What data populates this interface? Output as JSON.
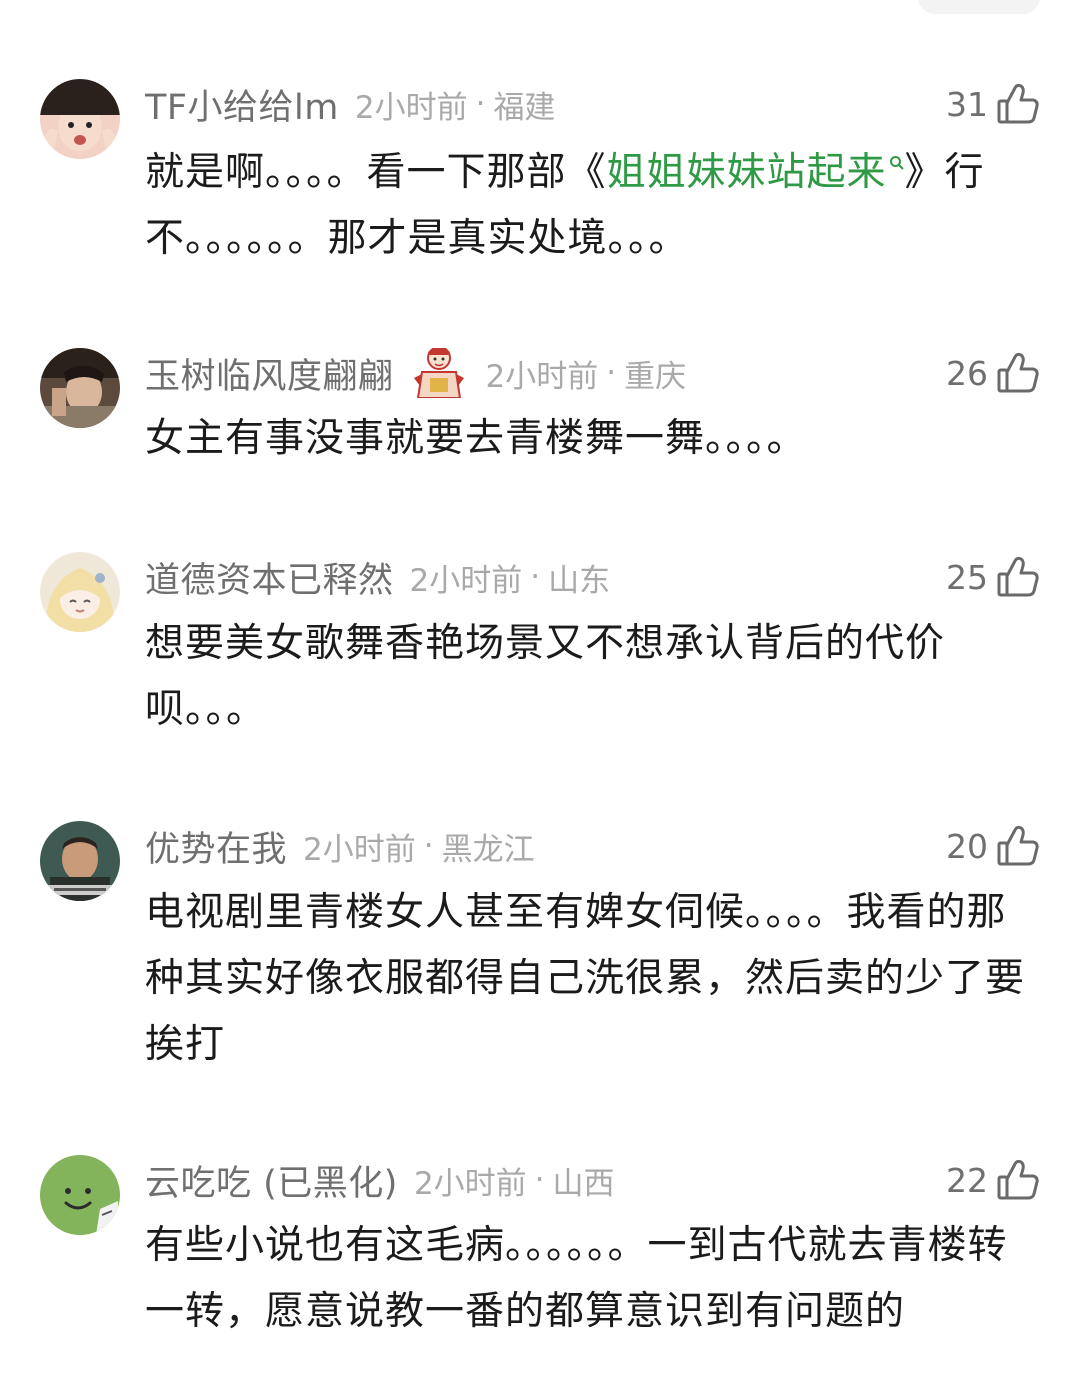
{
  "comments": [
    {
      "username": "TF小给给lm",
      "time": "2小时前",
      "separator": "·",
      "region": "福建",
      "likes": "31",
      "text_before": "就是啊。。。。看一下那部《",
      "link_text": "姐姐妹妹站起来",
      "text_after": "》行不。。。。。。那才是真实处境。。。",
      "avatar_icon": "avatar-photo-icon"
    },
    {
      "username": "玉树临风度翩翩",
      "time": "2小时前",
      "separator": "·",
      "region": "重庆",
      "likes": "26",
      "text": "女主有事没事就要去青楼舞一舞。。。。",
      "badge_icon": "fortune-god-badge-icon"
    },
    {
      "username": "道德资本已释然",
      "time": "2小时前",
      "separator": "·",
      "region": "山东",
      "likes": "25",
      "text": "想要美女歌舞香艳场景又不想承认背后的代价呗。。。"
    },
    {
      "username": "优势在我",
      "time": "2小时前",
      "separator": "·",
      "region": "黑龙江",
      "likes": "20",
      "text": "电视剧里青楼女人甚至有婢女伺候。。。。我看的那种其实好像衣服都得自己洗很累，然后卖的少了要挨打"
    },
    {
      "username": "云吃吃 (已黑化)",
      "time": "2小时前",
      "separator": "·",
      "region": "山西",
      "likes": "22",
      "text": "有些小说也有这毛病。。。。。。一到古代就去青楼转一转，愿意说教一番的都算意识到有问题的"
    }
  ],
  "colors": {
    "link": "#2f9a45",
    "username": "#6f6f6f",
    "meta": "#a9a9a9",
    "body": "#1b1b1b"
  }
}
